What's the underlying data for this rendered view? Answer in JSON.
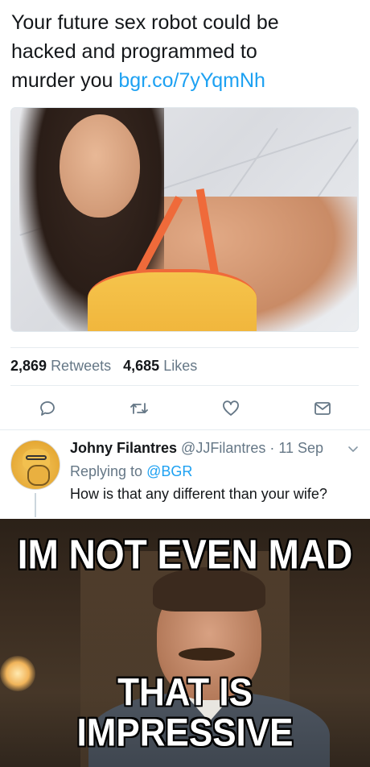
{
  "tweet": {
    "text_lines": [
      "Your future sex robot could be",
      "hacked and programmed to",
      "murder you "
    ],
    "link": "bgr.co/7yYqmNh",
    "photo_icon": "photo-image"
  },
  "stats": {
    "retweets_count": "2,869",
    "retweets_label": "Retweets",
    "likes_count": "4,685",
    "likes_label": "Likes"
  },
  "actions": {
    "reply_icon": "reply-icon",
    "retweet_icon": "retweet-icon",
    "like_icon": "heart-icon",
    "dm_icon": "envelope-icon"
  },
  "reply": {
    "name": "Johny Filantres",
    "handle": "@JJFilantres",
    "separator": " · ",
    "date": "11 Sep",
    "replying_prefix": "Replying to ",
    "replying_handle": "@BGR",
    "text": "How is that any different than your wife?"
  },
  "meme": {
    "top_text": "IM NOT EVEN MAD",
    "bottom_line1": "THAT IS",
    "bottom_line2": "IMPRESSIVE"
  },
  "colors": {
    "link": "#1da1f2",
    "secondary_text": "#657786",
    "primary_text": "#14171a"
  }
}
